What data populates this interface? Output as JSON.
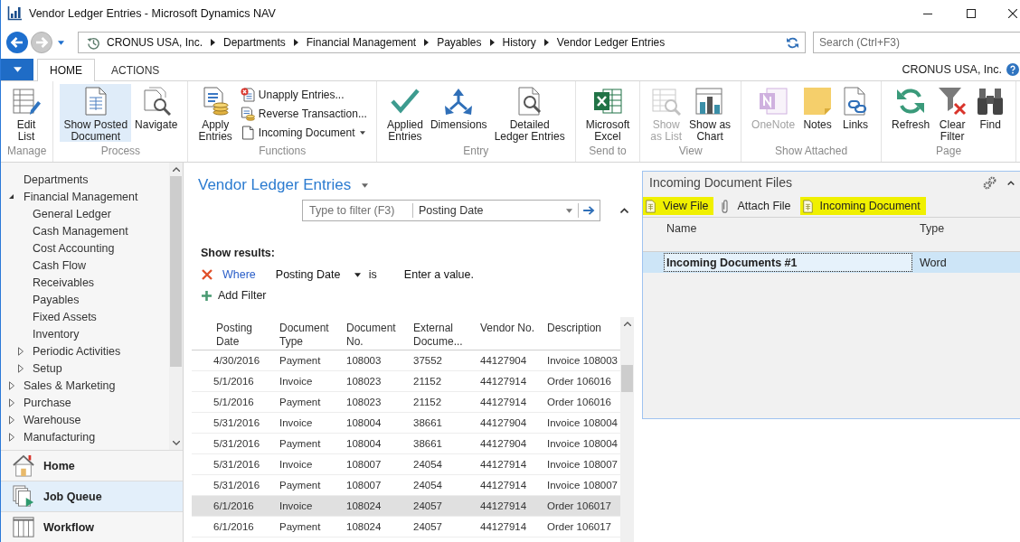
{
  "window": {
    "title": "Vendor Ledger Entries - Microsoft Dynamics NAV"
  },
  "address_bar": {
    "breadcrumb": [
      "CRONUS USA, Inc.",
      "Departments",
      "Financial Management",
      "Payables",
      "History",
      "Vendor Ledger Entries"
    ],
    "search": {
      "placeholder": "Search (Ctrl+F3)"
    }
  },
  "ribbon_tabs": [
    {
      "label": "HOME",
      "selected": true
    },
    {
      "label": "ACTIONS",
      "selected": false
    }
  ],
  "company": "CRONUS USA, Inc.",
  "ribbon": {
    "groups": [
      {
        "label": "Manage",
        "buttons": [
          {
            "kind": "large",
            "label": "Edit\nList",
            "disabled": false,
            "highlighted": false
          }
        ]
      },
      {
        "label": "Process",
        "buttons": [
          {
            "kind": "large",
            "label": "Show Posted\nDocument",
            "disabled": false,
            "highlighted": true
          },
          {
            "kind": "large",
            "label": "Navigate",
            "disabled": false,
            "highlighted": false
          }
        ]
      },
      {
        "label": "Functions",
        "buttons": [
          {
            "kind": "large",
            "label": "Apply\nEntries",
            "disabled": false,
            "highlighted": false
          },
          {
            "kind": "small",
            "label": "Unapply Entries...",
            "disabled": false,
            "highlighted": false,
            "dropdown": false
          },
          {
            "kind": "small",
            "label": "Reverse Transaction...",
            "disabled": false,
            "highlighted": false,
            "dropdown": false
          },
          {
            "kind": "small",
            "label": "Incoming Document",
            "disabled": false,
            "highlighted": false,
            "dropdown": true
          }
        ]
      },
      {
        "label": "Entry",
        "buttons": [
          {
            "kind": "large",
            "label": "Applied\nEntries",
            "disabled": false,
            "highlighted": false
          },
          {
            "kind": "large",
            "label": "Dimensions",
            "disabled": false,
            "highlighted": false
          },
          {
            "kind": "large",
            "label": "Detailed\nLedger Entries",
            "disabled": false,
            "highlighted": false
          }
        ]
      },
      {
        "label": "Send to",
        "buttons": [
          {
            "kind": "large",
            "label": "Microsoft\nExcel",
            "disabled": false,
            "highlighted": false
          }
        ]
      },
      {
        "label": "View",
        "buttons": [
          {
            "kind": "large",
            "label": "Show\nas List",
            "disabled": true,
            "highlighted": false
          },
          {
            "kind": "large",
            "label": "Show as\nChart",
            "disabled": false,
            "highlighted": false
          }
        ]
      },
      {
        "label": "Show Attached",
        "buttons": [
          {
            "kind": "large",
            "label": "OneNote",
            "disabled": true,
            "highlighted": false
          },
          {
            "kind": "large",
            "label": "Notes",
            "disabled": false,
            "highlighted": false
          },
          {
            "kind": "large",
            "label": "Links",
            "disabled": false,
            "highlighted": false
          }
        ]
      },
      {
        "label": "Page",
        "buttons": [
          {
            "kind": "large",
            "label": "Refresh",
            "disabled": false,
            "highlighted": false
          },
          {
            "kind": "large",
            "label": "Clear\nFilter",
            "disabled": false,
            "highlighted": false
          },
          {
            "kind": "large",
            "label": "Find",
            "disabled": false,
            "highlighted": false
          }
        ]
      }
    ]
  },
  "navigation": {
    "tree": [
      {
        "label": "Departments"
      },
      {
        "label": "Financial Management",
        "expanded": true,
        "children": [
          {
            "label": "General Ledger"
          },
          {
            "label": "Cash Management"
          },
          {
            "label": "Cost Accounting"
          },
          {
            "label": "Cash Flow"
          },
          {
            "label": "Receivables"
          },
          {
            "label": "Payables"
          },
          {
            "label": "Fixed Assets"
          },
          {
            "label": "Inventory"
          },
          {
            "label": "Periodic Activities",
            "expanded": false
          },
          {
            "label": "Setup",
            "expanded": false
          }
        ]
      },
      {
        "label": "Sales & Marketing",
        "expanded": false
      },
      {
        "label": "Purchase",
        "expanded": false
      },
      {
        "label": "Warehouse",
        "expanded": false
      },
      {
        "label": "Manufacturing",
        "expanded": false
      }
    ],
    "buttons": [
      {
        "label": "Home",
        "selected": false
      },
      {
        "label": "Job Queue",
        "selected": true
      },
      {
        "label": "Workflow",
        "selected": false
      }
    ]
  },
  "list": {
    "title": "Vendor Ledger Entries",
    "filter": {
      "placeholder": "Type to filter (F3)",
      "column": "Posting Date"
    },
    "show_results": "Show results:",
    "conditions": [
      {
        "link": "Where",
        "field": "Posting Date",
        "operator": "is",
        "placeholder": "Enter a value."
      }
    ],
    "add_filter": "Add Filter"
  },
  "table": {
    "columns": [
      "Posting Date",
      "Document Type",
      "Document No.",
      "External Docume...",
      "Vendor No.",
      "Description"
    ],
    "rows": [
      {
        "cells": [
          "4/30/2016",
          "Payment",
          "108003",
          "37552",
          "44127904",
          "Invoice 108003"
        ],
        "selected": false
      },
      {
        "cells": [
          "5/1/2016",
          "Invoice",
          "108023",
          "21152",
          "44127914",
          "Order 106016"
        ],
        "selected": false
      },
      {
        "cells": [
          "5/1/2016",
          "Payment",
          "108023",
          "21152",
          "44127914",
          "Order 106016"
        ],
        "selected": false
      },
      {
        "cells": [
          "5/31/2016",
          "Invoice",
          "108004",
          "38661",
          "44127904",
          "Invoice 108004"
        ],
        "selected": false
      },
      {
        "cells": [
          "5/31/2016",
          "Payment",
          "108004",
          "38661",
          "44127904",
          "Invoice 108004"
        ],
        "selected": false
      },
      {
        "cells": [
          "5/31/2016",
          "Invoice",
          "108007",
          "24054",
          "44127914",
          "Invoice 108007"
        ],
        "selected": false
      },
      {
        "cells": [
          "5/31/2016",
          "Payment",
          "108007",
          "24054",
          "44127914",
          "Invoice 108007"
        ],
        "selected": false
      },
      {
        "cells": [
          "6/1/2016",
          "Invoice",
          "108024",
          "24057",
          "44127914",
          "Order 106017"
        ],
        "selected": true
      },
      {
        "cells": [
          "6/1/2016",
          "Payment",
          "108024",
          "24057",
          "44127914",
          "Order 106017"
        ],
        "selected": false
      }
    ]
  },
  "factbox": {
    "title": "Incoming Document Files",
    "actions": [
      {
        "label": "View File",
        "highlighted": true
      },
      {
        "label": "Attach File",
        "highlighted": false
      },
      {
        "label": "Incoming Document",
        "highlighted": true
      }
    ],
    "columns": [
      "Name",
      "Type"
    ],
    "rows": [
      {
        "name": "Incoming Documents #1",
        "type": "Word",
        "selected": true
      }
    ]
  }
}
